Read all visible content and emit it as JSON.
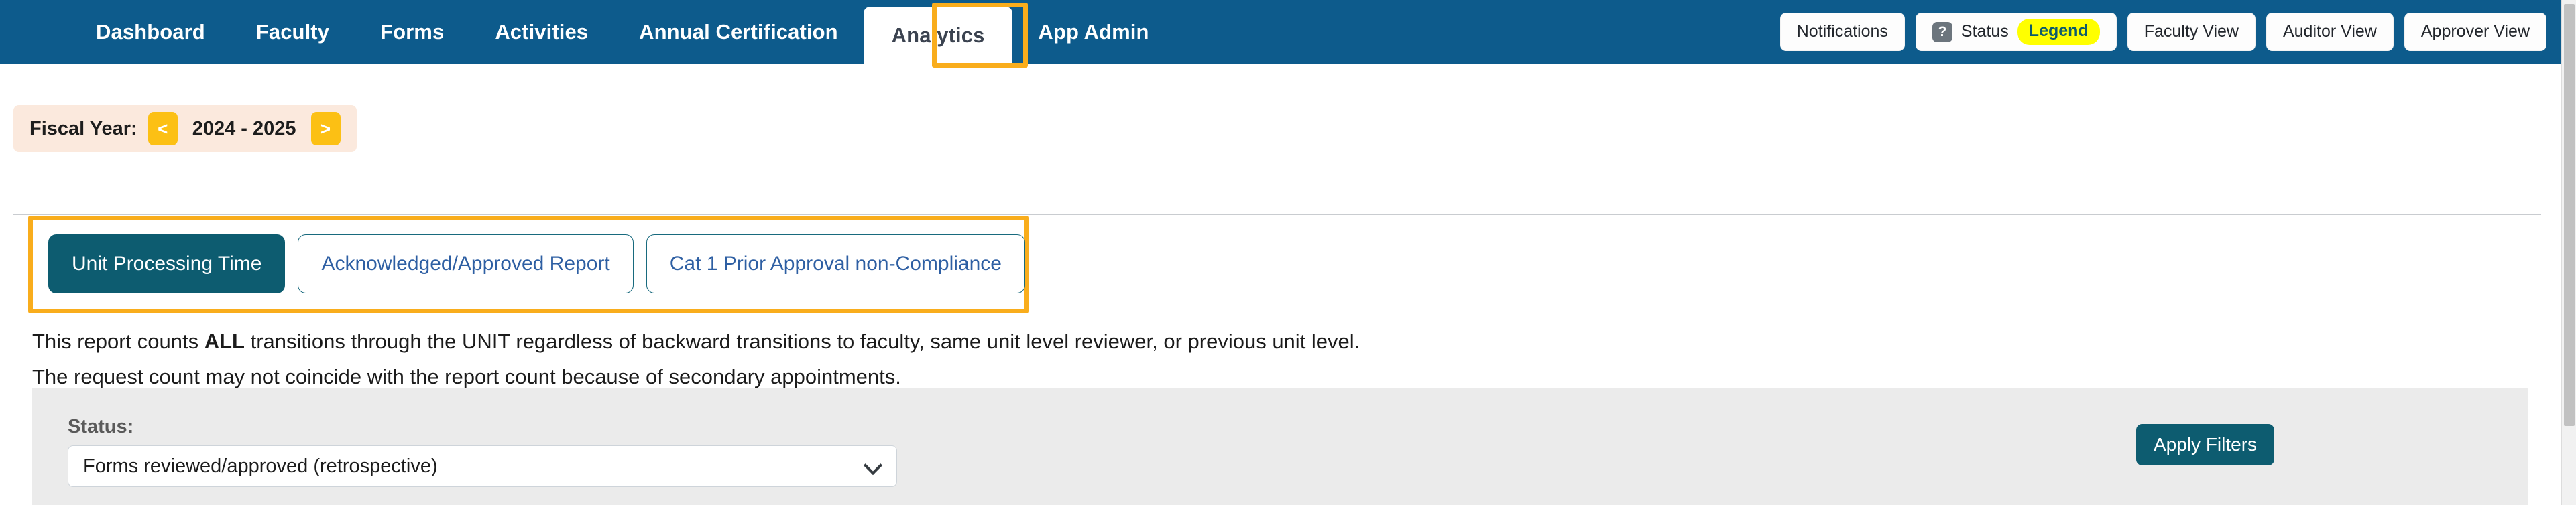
{
  "navbar": {
    "bg_color": "#0d5b8c",
    "items": [
      {
        "label": "Dashboard",
        "active": false
      },
      {
        "label": "Faculty",
        "active": false
      },
      {
        "label": "Forms",
        "active": false
      },
      {
        "label": "Activities",
        "active": false
      },
      {
        "label": "Annual Certification",
        "active": false
      },
      {
        "label": "Analytics",
        "active": true
      },
      {
        "label": "App Admin",
        "active": false
      }
    ],
    "actions": {
      "notifications_label": "Notifications",
      "status_icon": "question-mark-icon",
      "status_label": "Status",
      "legend_badge": "Legend",
      "legend_badge_color": "#ffff00",
      "faculty_view_label": "Faculty View",
      "auditor_view_label": "Auditor View",
      "approver_view_label": "Approver View"
    },
    "focus_highlight_color": "#f9ad1c"
  },
  "fiscal_year": {
    "label": "Fiscal Year:",
    "prev_label": "<",
    "next_label": ">",
    "value": "2024 - 2025",
    "bar_color": "#fbe9dd",
    "arrow_color": "#fcc014"
  },
  "reports": {
    "highlight_color": "#f9ad1c",
    "tabs": [
      {
        "label": "Unit Processing Time",
        "active": true
      },
      {
        "label": "Acknowledged/Approved Report",
        "active": false
      },
      {
        "label": "Cat 1 Prior Approval non-Compliance",
        "active": false
      }
    ],
    "active_color": "#0d5c70"
  },
  "description": {
    "line1_part1": "This report counts ",
    "line1_bold": "ALL",
    "line1_part2": " transitions through the UNIT regardless of backward transitions to faculty, same unit level reviewer, or previous unit level.",
    "line2": "The request count may not coincide with the report count because of secondary appointments."
  },
  "filters": {
    "panel_color": "#ebebeb",
    "status_label": "Status:",
    "status_value": "Forms reviewed/approved (retrospective)",
    "status_options": [
      "Forms reviewed/approved (retrospective)"
    ],
    "dropdown_icon": "chevron-down-icon",
    "apply_label": "Apply Filters",
    "apply_color": "#0d5c70"
  },
  "scrollbar": {
    "orientation": "vertical",
    "thumb_color": "#c1c1c1"
  }
}
